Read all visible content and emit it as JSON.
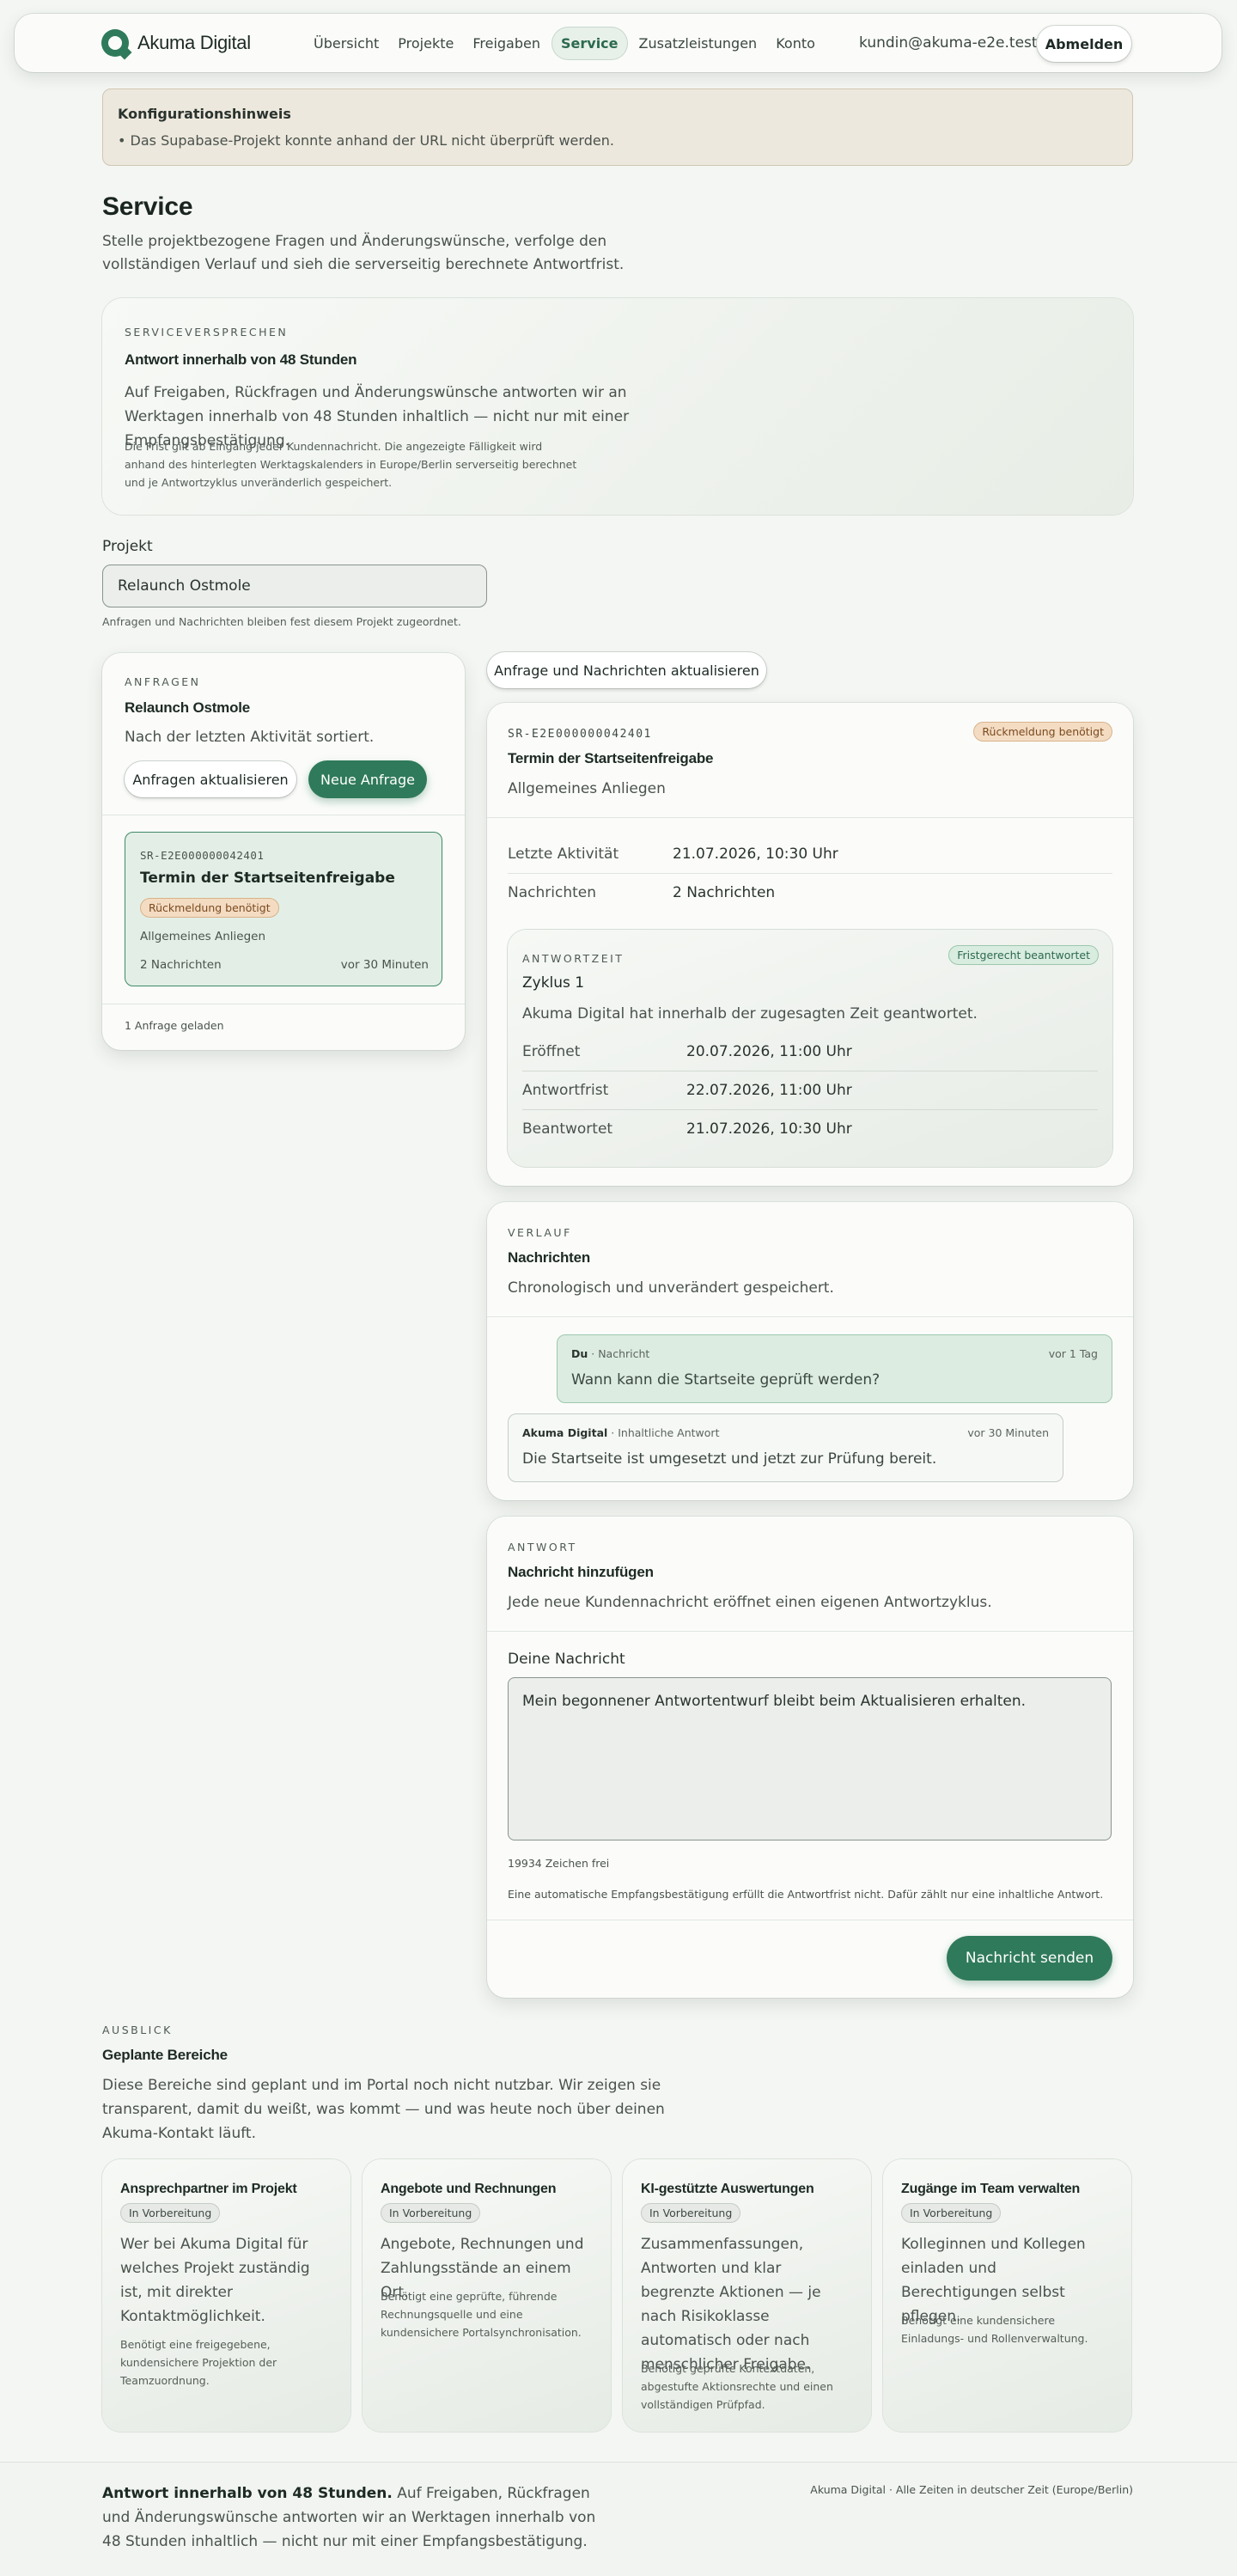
{
  "header": {
    "brand": "Akuma Digital",
    "nav": [
      "Übersicht",
      "Projekte",
      "Freigaben",
      "Service",
      "Zusatzleistungen",
      "Konto"
    ],
    "active_nav": "Service",
    "user_email": "kundin@akuma-e2e.test",
    "logout_label": "Abmelden"
  },
  "notice": {
    "title": "Konfigurationshinweis",
    "item": "Das Supabase-Projekt konnte anhand der URL nicht überprüft werden."
  },
  "page": {
    "title": "Service",
    "intro": "Stelle projektbezogene Fragen und Änderungswünsche, verfolge den vollständigen Verlauf und sieh die serverseitig berechnete Antwortfrist."
  },
  "promise": {
    "eyebrow": "SERVICEVERSPRECHEN",
    "title": "Antwort innerhalb von 48 Stunden",
    "body": "Auf Freigaben, Rückfragen und Änderungswünsche antworten wir an Werktagen innerhalb von 48 Stunden inhaltlich — nicht nur mit einer Empfangsbestätigung.",
    "note": "Die Frist gilt ab Eingang jeder Kundennachricht. Die angezeigte Fälligkeit wird anhand des hinterlegten Werktagskalenders in Europe/Berlin serverseitig berechnet und je Antwortzyklus unveränderlich gespeichert."
  },
  "project": {
    "label": "Projekt",
    "selected": "Relaunch Ostmole",
    "hint": "Anfragen und Nachrichten bleiben fest diesem Projekt zugeordnet."
  },
  "requests": {
    "eyebrow": "ANFRAGEN",
    "title": "Relaunch Ostmole",
    "subtitle": "Nach der letzten Aktivität sortiert.",
    "refresh_label": "Anfragen aktualisieren",
    "new_label": "Neue Anfrage",
    "items": [
      {
        "id": "SR-E2E000000042401",
        "title": "Termin der Startseitenfreigabe",
        "badge": "Rückmeldung benötigt",
        "category": "Allgemeines Anliegen",
        "messages": "2 Nachrichten",
        "age": "vor 30 Minuten"
      }
    ],
    "footer": "1 Anfrage geladen"
  },
  "refresh_all_label": "Anfrage und Nachrichten aktualisieren",
  "detail": {
    "id": "SR-E2E000000042401",
    "badge": "Rückmeldung benötigt",
    "title": "Termin der Startseitenfreigabe",
    "category": "Allgemeines Anliegen",
    "last_activity_label": "Letzte Aktivität",
    "last_activity": "21.07.2026, 10:30 Uhr",
    "messages_label": "Nachrichten",
    "messages": "2 Nachrichten",
    "cycle": {
      "eyebrow": "ANTWORTZEIT",
      "badge": "Fristgerecht beantwortet",
      "title": "Zyklus 1",
      "body": "Akuma Digital hat innerhalb der zugesagten Zeit geantwortet.",
      "opened_label": "Eröffnet",
      "opened": "20.07.2026, 11:00 Uhr",
      "deadline_label": "Antwortfrist",
      "deadline": "22.07.2026, 11:00 Uhr",
      "answered_label": "Beantwortet",
      "answered": "21.07.2026, 10:30 Uhr"
    }
  },
  "history": {
    "eyebrow": "VERLAUF",
    "title": "Nachrichten",
    "subtitle": "Chronologisch und unverändert gespeichert.",
    "messages": [
      {
        "author": "Du",
        "kind": " · Nachricht",
        "time": "vor 1 Tag",
        "text": "Wann kann die Startseite geprüft werden?"
      },
      {
        "author": "Akuma Digital",
        "kind": " · Inhaltliche Antwort",
        "time": "vor 30 Minuten",
        "text": "Die Startseite ist umgesetzt und jetzt zur Prüfung bereit."
      }
    ]
  },
  "reply": {
    "eyebrow": "ANTWORT",
    "title": "Nachricht hinzufügen",
    "subtitle": "Jede neue Kundennachricht eröffnet einen eigenen Antwortzyklus.",
    "field_label": "Deine Nachricht",
    "draft": "Mein begonnener Antwortentwurf bleibt beim Aktualisieren erhalten.",
    "counter": "19934 Zeichen frei",
    "note": "Eine automatische Empfangsbestätigung erfüllt die Antwortfrist nicht. Dafür zählt nur eine inhaltliche Antwort.",
    "send_label": "Nachricht senden"
  },
  "outlook": {
    "eyebrow": "AUSBLICK",
    "title": "Geplante Bereiche",
    "body": "Diese Bereiche sind geplant und im Portal noch nicht nutzbar. Wir zeigen sie transparent, damit du weißt, was kommt — und was heute noch über deinen Akuma-Kontakt läuft.",
    "cards": [
      {
        "title": "Ansprechpartner im Projekt",
        "badge": "In Vorbereitung",
        "body": "Wer bei Akuma Digital für welches Projekt zuständig ist, mit direkter Kontaktmöglichkeit.",
        "note": "Benötigt eine freigegebene, kundensichere Projektion der Teamzuordnung."
      },
      {
        "title": "Angebote und Rechnungen",
        "badge": "In Vorbereitung",
        "body": "Angebote, Rechnungen und Zahlungsstände an einem Ort.",
        "note": "Benötigt eine geprüfte, führende Rechnungsquelle und eine kundensichere Portalsynchronisation."
      },
      {
        "title": "KI-gestützte Auswertungen",
        "badge": "In Vorbereitung",
        "body": "Zusammenfassungen, Antworten und klar begrenzte Aktionen — je nach Risikoklasse automatisch oder nach menschlicher Freigabe.",
        "note": "Benötigt geprüfte Kontextdaten, abgestufte Aktionsrechte und einen vollständigen Prüfpfad."
      },
      {
        "title": "Zugänge im Team verwalten",
        "badge": "In Vorbereitung",
        "body": "Kolleginnen und Kollegen einladen und Berechtigungen selbst pflegen.",
        "note": "Benötigt eine kundensichere Einladungs- und Rollenverwaltung."
      }
    ]
  },
  "footer": {
    "lead": "Antwort innerhalb von 48 Stunden.",
    "text": " Auf Freigaben, Rückfragen und Änderungswünsche antworten wir an Werktagen innerhalb von 48 Stunden inhaltlich — nicht nur mit einer Empfangsbestätigung.",
    "right": "Akuma Digital · Alle Zeiten in deutscher Zeit (Europe/Berlin)"
  }
}
